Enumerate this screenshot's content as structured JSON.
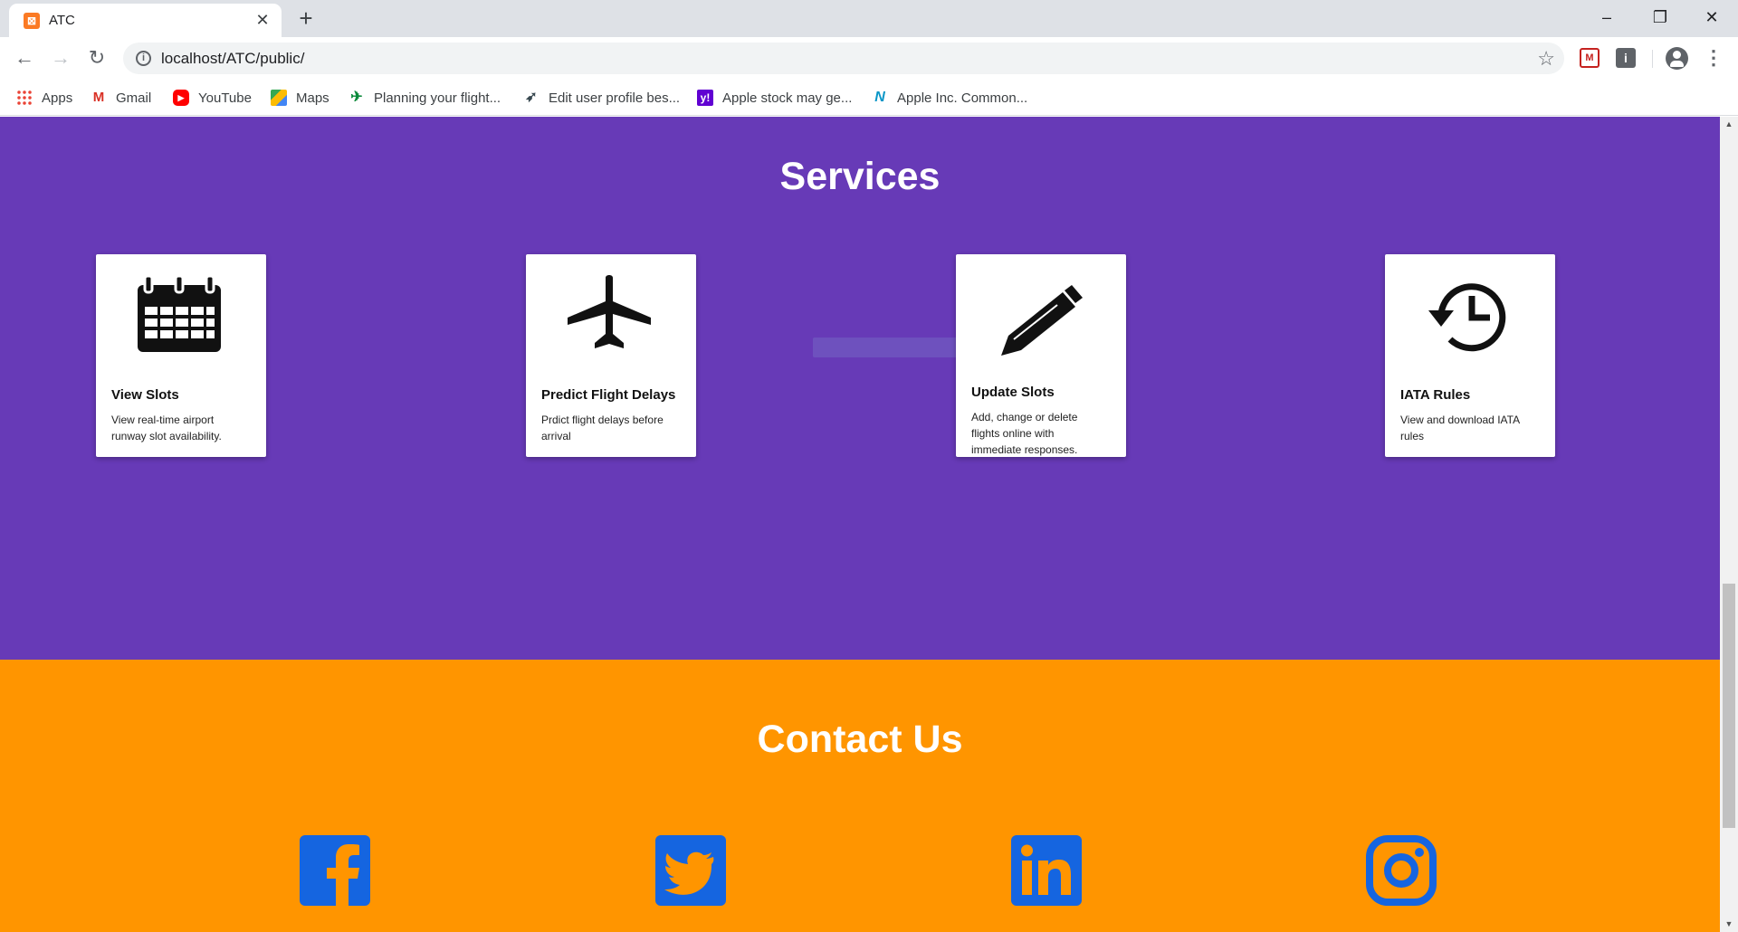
{
  "browser": {
    "tab_title": "ATC",
    "url": "localhost/ATC/public/",
    "bookmarks": [
      {
        "label": "Apps",
        "icon": "apps-grid-icon"
      },
      {
        "label": "Gmail",
        "icon": "gmail-icon"
      },
      {
        "label": "YouTube",
        "icon": "youtube-icon"
      },
      {
        "label": "Maps",
        "icon": "maps-icon"
      },
      {
        "label": "Planning your flight...",
        "icon": "airline-icon"
      },
      {
        "label": "Edit user profile bes...",
        "icon": "paper-plane-icon"
      },
      {
        "label": "Apple stock may ge...",
        "icon": "yahoo-icon"
      },
      {
        "label": "Apple Inc. Common...",
        "icon": "nasdaq-icon"
      }
    ]
  },
  "services": {
    "title": "Services",
    "cards": [
      {
        "title": "View Slots",
        "description": "View real-time airport runway slot availability.",
        "icon": "calendar-icon"
      },
      {
        "title": "Predict Flight Delays",
        "description": "Prdict flight delays before arrival",
        "icon": "airplane-icon"
      },
      {
        "title": "Update Slots",
        "description": "Add, change or delete flights online with immediate responses.",
        "icon": "pencil-icon"
      },
      {
        "title": "IATA Rules",
        "description": "View and download IATA rules",
        "icon": "history-clock-icon"
      }
    ]
  },
  "contact": {
    "title": "Contact Us",
    "social": [
      "facebook-icon",
      "twitter-icon",
      "linkedin-icon",
      "instagram-icon"
    ],
    "accent_color": "#1565e0"
  },
  "colors": {
    "services_bg": "#673ab7",
    "contact_bg": "#ff9500"
  }
}
